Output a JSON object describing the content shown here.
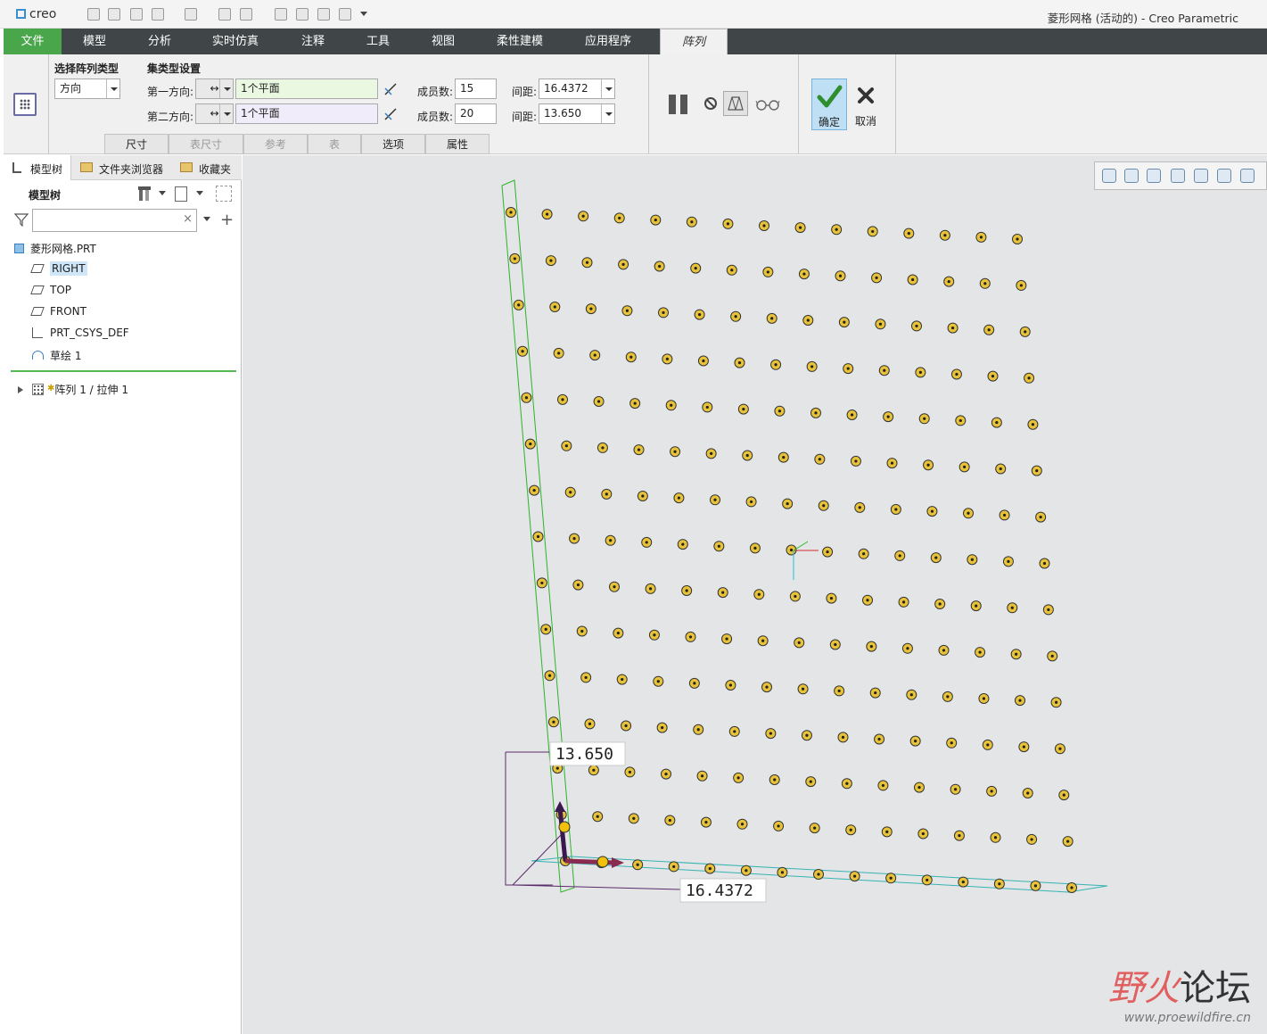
{
  "app": {
    "logo_text": "creo",
    "window_title": "菱形网格 (活动的) - Creo Parametric"
  },
  "ribbon_tabs": [
    "文件",
    "模型",
    "分析",
    "实时仿真",
    "注释",
    "工具",
    "视图",
    "柔性建模",
    "应用程序",
    "阵列"
  ],
  "pattern": {
    "type_label": "选择阵列类型",
    "type_value": "方向",
    "set_label": "集类型设置",
    "dir1": {
      "label": "第一方向:",
      "reference": "1个平面",
      "members_label": "成员数:",
      "members": "15",
      "spacing_label": "间距:",
      "spacing": "16.4372"
    },
    "dir2": {
      "label": "第二方向:",
      "reference": "1个平面",
      "members_label": "成员数:",
      "members": "20",
      "spacing_label": "间距:",
      "spacing": "13.650"
    },
    "subtabs": [
      "尺寸",
      "表尺寸",
      "参考",
      "表",
      "选项",
      "属性"
    ],
    "ok_label": "确定",
    "cancel_label": "取消"
  },
  "left_panel": {
    "tabs": [
      "模型树",
      "文件夹浏览器",
      "收藏夹"
    ],
    "header": "模型树",
    "filter_placeholder": "",
    "items": [
      {
        "label": "菱形网格.PRT"
      },
      {
        "label": "RIGHT"
      },
      {
        "label": "TOP"
      },
      {
        "label": "FRONT"
      },
      {
        "label": "PRT_CSYS_DEF"
      },
      {
        "label": "草绘 1"
      },
      {
        "label": "阵列 1 / 拉伸 1"
      }
    ]
  },
  "viewport": {
    "dim_dir2": "13.650",
    "dim_dir1": "16.4372",
    "grid_cols": 15,
    "grid_rows": 15,
    "point_color": "#e8c33a"
  },
  "watermark": {
    "text_a": "野火",
    "text_b": "论坛",
    "url": "www.proewildfire.cn"
  },
  "colors": {
    "accent_green": "#4aa64a",
    "tabbar": "#404648",
    "plane_green": "#2bb52b",
    "plane_cyan": "#36b3b3"
  }
}
